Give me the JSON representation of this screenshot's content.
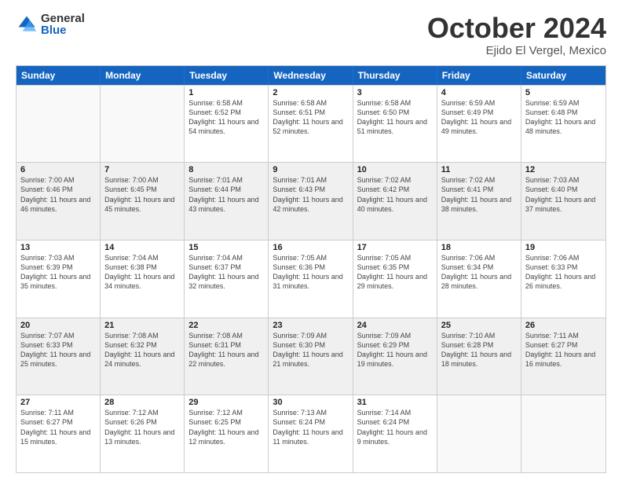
{
  "logo": {
    "general": "General",
    "blue": "Blue"
  },
  "title": {
    "month": "October 2024",
    "location": "Ejido El Vergel, Mexico"
  },
  "header_days": [
    "Sunday",
    "Monday",
    "Tuesday",
    "Wednesday",
    "Thursday",
    "Friday",
    "Saturday"
  ],
  "weeks": [
    [
      {
        "day": "",
        "sunrise": "",
        "sunset": "",
        "daylight": "",
        "empty": true
      },
      {
        "day": "",
        "sunrise": "",
        "sunset": "",
        "daylight": "",
        "empty": true
      },
      {
        "day": "1",
        "sunrise": "Sunrise: 6:58 AM",
        "sunset": "Sunset: 6:52 PM",
        "daylight": "Daylight: 11 hours and 54 minutes."
      },
      {
        "day": "2",
        "sunrise": "Sunrise: 6:58 AM",
        "sunset": "Sunset: 6:51 PM",
        "daylight": "Daylight: 11 hours and 52 minutes."
      },
      {
        "day": "3",
        "sunrise": "Sunrise: 6:58 AM",
        "sunset": "Sunset: 6:50 PM",
        "daylight": "Daylight: 11 hours and 51 minutes."
      },
      {
        "day": "4",
        "sunrise": "Sunrise: 6:59 AM",
        "sunset": "Sunset: 6:49 PM",
        "daylight": "Daylight: 11 hours and 49 minutes."
      },
      {
        "day": "5",
        "sunrise": "Sunrise: 6:59 AM",
        "sunset": "Sunset: 6:48 PM",
        "daylight": "Daylight: 11 hours and 48 minutes."
      }
    ],
    [
      {
        "day": "6",
        "sunrise": "Sunrise: 7:00 AM",
        "sunset": "Sunset: 6:46 PM",
        "daylight": "Daylight: 11 hours and 46 minutes.",
        "shaded": true
      },
      {
        "day": "7",
        "sunrise": "Sunrise: 7:00 AM",
        "sunset": "Sunset: 6:45 PM",
        "daylight": "Daylight: 11 hours and 45 minutes.",
        "shaded": true
      },
      {
        "day": "8",
        "sunrise": "Sunrise: 7:01 AM",
        "sunset": "Sunset: 6:44 PM",
        "daylight": "Daylight: 11 hours and 43 minutes.",
        "shaded": true
      },
      {
        "day": "9",
        "sunrise": "Sunrise: 7:01 AM",
        "sunset": "Sunset: 6:43 PM",
        "daylight": "Daylight: 11 hours and 42 minutes.",
        "shaded": true
      },
      {
        "day": "10",
        "sunrise": "Sunrise: 7:02 AM",
        "sunset": "Sunset: 6:42 PM",
        "daylight": "Daylight: 11 hours and 40 minutes.",
        "shaded": true
      },
      {
        "day": "11",
        "sunrise": "Sunrise: 7:02 AM",
        "sunset": "Sunset: 6:41 PM",
        "daylight": "Daylight: 11 hours and 38 minutes.",
        "shaded": true
      },
      {
        "day": "12",
        "sunrise": "Sunrise: 7:03 AM",
        "sunset": "Sunset: 6:40 PM",
        "daylight": "Daylight: 11 hours and 37 minutes.",
        "shaded": true
      }
    ],
    [
      {
        "day": "13",
        "sunrise": "Sunrise: 7:03 AM",
        "sunset": "Sunset: 6:39 PM",
        "daylight": "Daylight: 11 hours and 35 minutes."
      },
      {
        "day": "14",
        "sunrise": "Sunrise: 7:04 AM",
        "sunset": "Sunset: 6:38 PM",
        "daylight": "Daylight: 11 hours and 34 minutes."
      },
      {
        "day": "15",
        "sunrise": "Sunrise: 7:04 AM",
        "sunset": "Sunset: 6:37 PM",
        "daylight": "Daylight: 11 hours and 32 minutes."
      },
      {
        "day": "16",
        "sunrise": "Sunrise: 7:05 AM",
        "sunset": "Sunset: 6:36 PM",
        "daylight": "Daylight: 11 hours and 31 minutes."
      },
      {
        "day": "17",
        "sunrise": "Sunrise: 7:05 AM",
        "sunset": "Sunset: 6:35 PM",
        "daylight": "Daylight: 11 hours and 29 minutes."
      },
      {
        "day": "18",
        "sunrise": "Sunrise: 7:06 AM",
        "sunset": "Sunset: 6:34 PM",
        "daylight": "Daylight: 11 hours and 28 minutes."
      },
      {
        "day": "19",
        "sunrise": "Sunrise: 7:06 AM",
        "sunset": "Sunset: 6:33 PM",
        "daylight": "Daylight: 11 hours and 26 minutes."
      }
    ],
    [
      {
        "day": "20",
        "sunrise": "Sunrise: 7:07 AM",
        "sunset": "Sunset: 6:33 PM",
        "daylight": "Daylight: 11 hours and 25 minutes.",
        "shaded": true
      },
      {
        "day": "21",
        "sunrise": "Sunrise: 7:08 AM",
        "sunset": "Sunset: 6:32 PM",
        "daylight": "Daylight: 11 hours and 24 minutes.",
        "shaded": true
      },
      {
        "day": "22",
        "sunrise": "Sunrise: 7:08 AM",
        "sunset": "Sunset: 6:31 PM",
        "daylight": "Daylight: 11 hours and 22 minutes.",
        "shaded": true
      },
      {
        "day": "23",
        "sunrise": "Sunrise: 7:09 AM",
        "sunset": "Sunset: 6:30 PM",
        "daylight": "Daylight: 11 hours and 21 minutes.",
        "shaded": true
      },
      {
        "day": "24",
        "sunrise": "Sunrise: 7:09 AM",
        "sunset": "Sunset: 6:29 PM",
        "daylight": "Daylight: 11 hours and 19 minutes.",
        "shaded": true
      },
      {
        "day": "25",
        "sunrise": "Sunrise: 7:10 AM",
        "sunset": "Sunset: 6:28 PM",
        "daylight": "Daylight: 11 hours and 18 minutes.",
        "shaded": true
      },
      {
        "day": "26",
        "sunrise": "Sunrise: 7:11 AM",
        "sunset": "Sunset: 6:27 PM",
        "daylight": "Daylight: 11 hours and 16 minutes.",
        "shaded": true
      }
    ],
    [
      {
        "day": "27",
        "sunrise": "Sunrise: 7:11 AM",
        "sunset": "Sunset: 6:27 PM",
        "daylight": "Daylight: 11 hours and 15 minutes."
      },
      {
        "day": "28",
        "sunrise": "Sunrise: 7:12 AM",
        "sunset": "Sunset: 6:26 PM",
        "daylight": "Daylight: 11 hours and 13 minutes."
      },
      {
        "day": "29",
        "sunrise": "Sunrise: 7:12 AM",
        "sunset": "Sunset: 6:25 PM",
        "daylight": "Daylight: 11 hours and 12 minutes."
      },
      {
        "day": "30",
        "sunrise": "Sunrise: 7:13 AM",
        "sunset": "Sunset: 6:24 PM",
        "daylight": "Daylight: 11 hours and 11 minutes."
      },
      {
        "day": "31",
        "sunrise": "Sunrise: 7:14 AM",
        "sunset": "Sunset: 6:24 PM",
        "daylight": "Daylight: 11 hours and 9 minutes."
      },
      {
        "day": "",
        "sunrise": "",
        "sunset": "",
        "daylight": "",
        "empty": true
      },
      {
        "day": "",
        "sunrise": "",
        "sunset": "",
        "daylight": "",
        "empty": true
      }
    ]
  ]
}
